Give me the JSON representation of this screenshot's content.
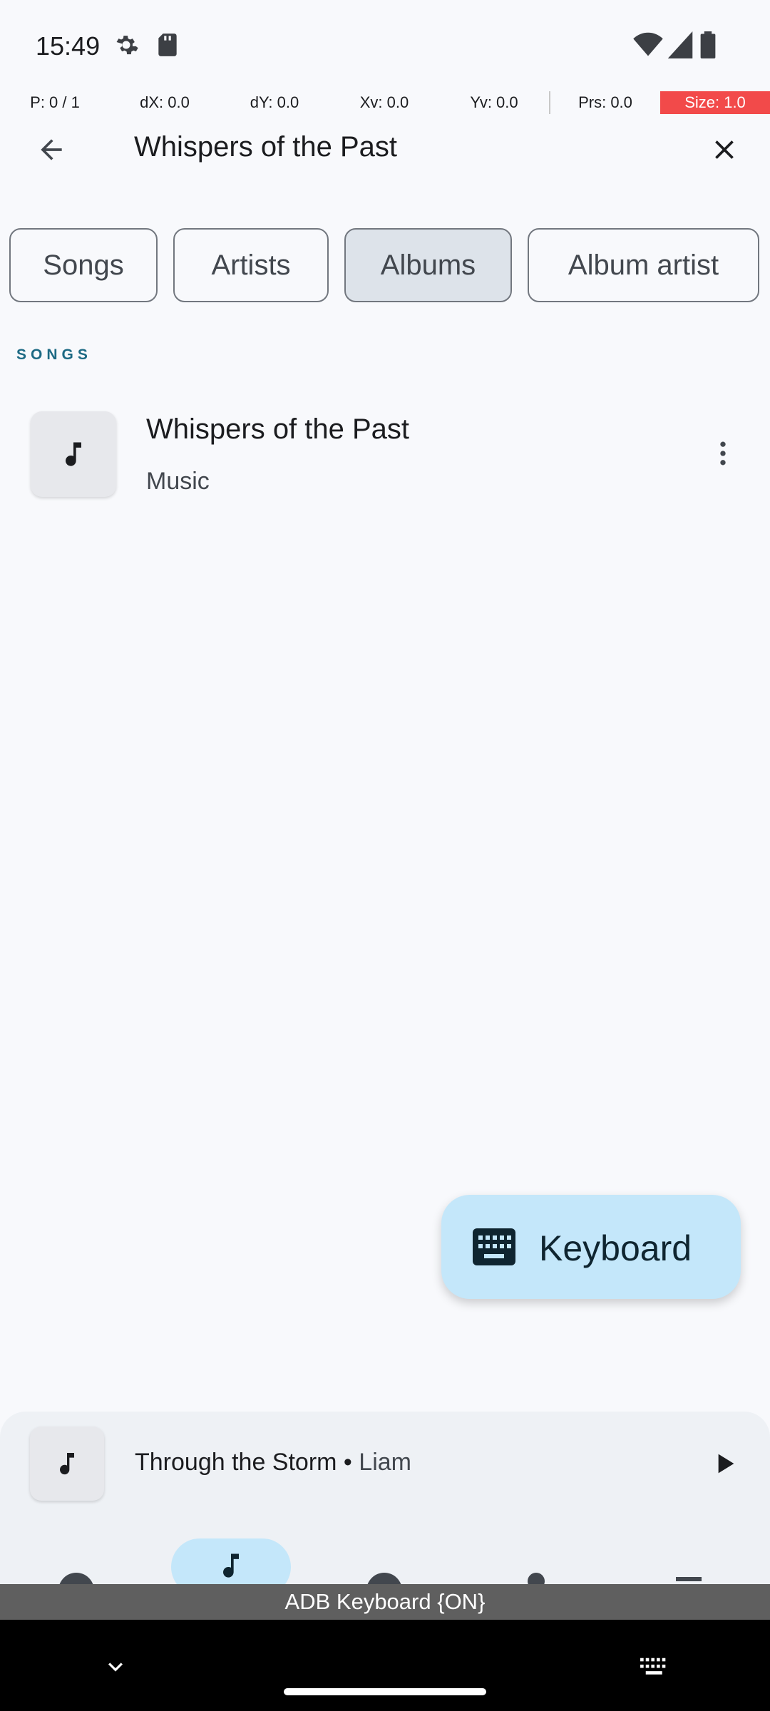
{
  "status_bar": {
    "time": "15:49"
  },
  "pointer_overlay": {
    "p": "P: 0 / 1",
    "dx": "dX: 0.0",
    "dy": "dY: 0.0",
    "xv": "Xv: 0.0",
    "yv": "Yv: 0.0",
    "prs": "Prs: 0.0",
    "size": "Size: 1.0"
  },
  "search": {
    "query": "Whispers of the Past"
  },
  "chips": [
    {
      "label": "Songs",
      "selected": false
    },
    {
      "label": "Artists",
      "selected": false
    },
    {
      "label": "Albums",
      "selected": true
    },
    {
      "label": "Album artist",
      "selected": false
    }
  ],
  "section": {
    "title": "SONGS"
  },
  "songs": [
    {
      "title": "Whispers of the Past",
      "subtitle": "Music"
    }
  ],
  "fab": {
    "label": "Keyboard"
  },
  "mini_player": {
    "title": "Through the Storm",
    "separator": " • ",
    "artist": "Liam"
  },
  "adb_keyboard": {
    "label": "ADB Keyboard {ON}"
  },
  "colors": {
    "accent": "#1D6A84",
    "fab_bg": "#C4E7FA",
    "selected_chip": "#DDE3EA",
    "overlay_size_bg": "#F24A4A"
  }
}
